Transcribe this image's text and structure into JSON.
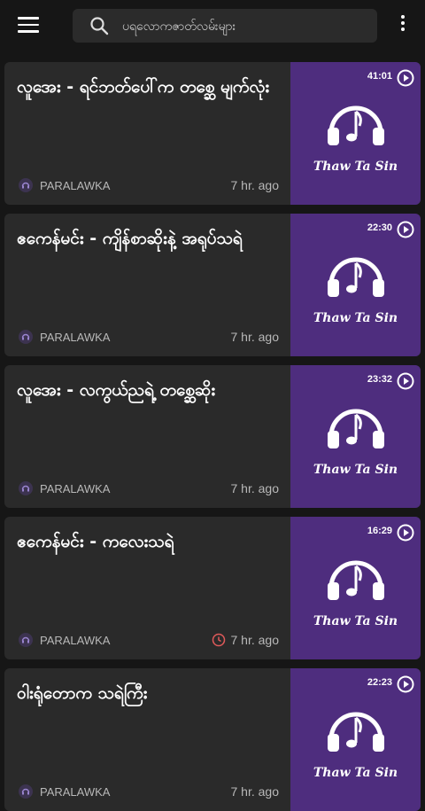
{
  "search": {
    "placeholder": "ပရလောကဇာတ်လမ်းများ"
  },
  "icons": {
    "menu": "menu-icon",
    "search": "search-icon",
    "more": "more-vert-icon",
    "play": "play-circle-icon",
    "clock": "clock-icon",
    "headphones": "headphones-music-icon"
  },
  "colors": {
    "background": "#161616",
    "card": "#2a2a2a",
    "thumbnail": "#4e2d7e",
    "text_secondary": "#b8b8b8",
    "clock_accent": "#e05a5a"
  },
  "feed": [
    {
      "title": "လူအေး - ရင်ဘတ်ပေါ်က တစ္ဆေ မျက်လုံး",
      "channel": "PARALAWKA",
      "time": "7 hr. ago",
      "duration": "41:01",
      "brand": "Thaw Ta Sin"
    },
    {
      "title": "ဧကေန်မင်း - ကျိန်စာဆိုးနဲ့ အရုပ်သရဲ",
      "channel": "PARALAWKA",
      "time": "7 hr. ago",
      "duration": "22:30",
      "brand": "Thaw Ta Sin"
    },
    {
      "title": "လူအေး - လကွယ်ညရဲ့ တစ္ဆေဆိုး",
      "channel": "PARALAWKA",
      "time": "7 hr. ago",
      "duration": "23:32",
      "brand": "Thaw Ta Sin"
    },
    {
      "title": "ဧကေန်မင်း - ကလေးသရဲ",
      "channel": "PARALAWKA",
      "time": "7 hr. ago",
      "duration": "16:29",
      "brand": "Thaw Ta Sin"
    },
    {
      "title": "ဝါးရုံတောက သရဲကြီး",
      "channel": "PARALAWKA",
      "time": "7 hr. ago",
      "duration": "22:23",
      "brand": "Thaw Ta Sin"
    }
  ]
}
